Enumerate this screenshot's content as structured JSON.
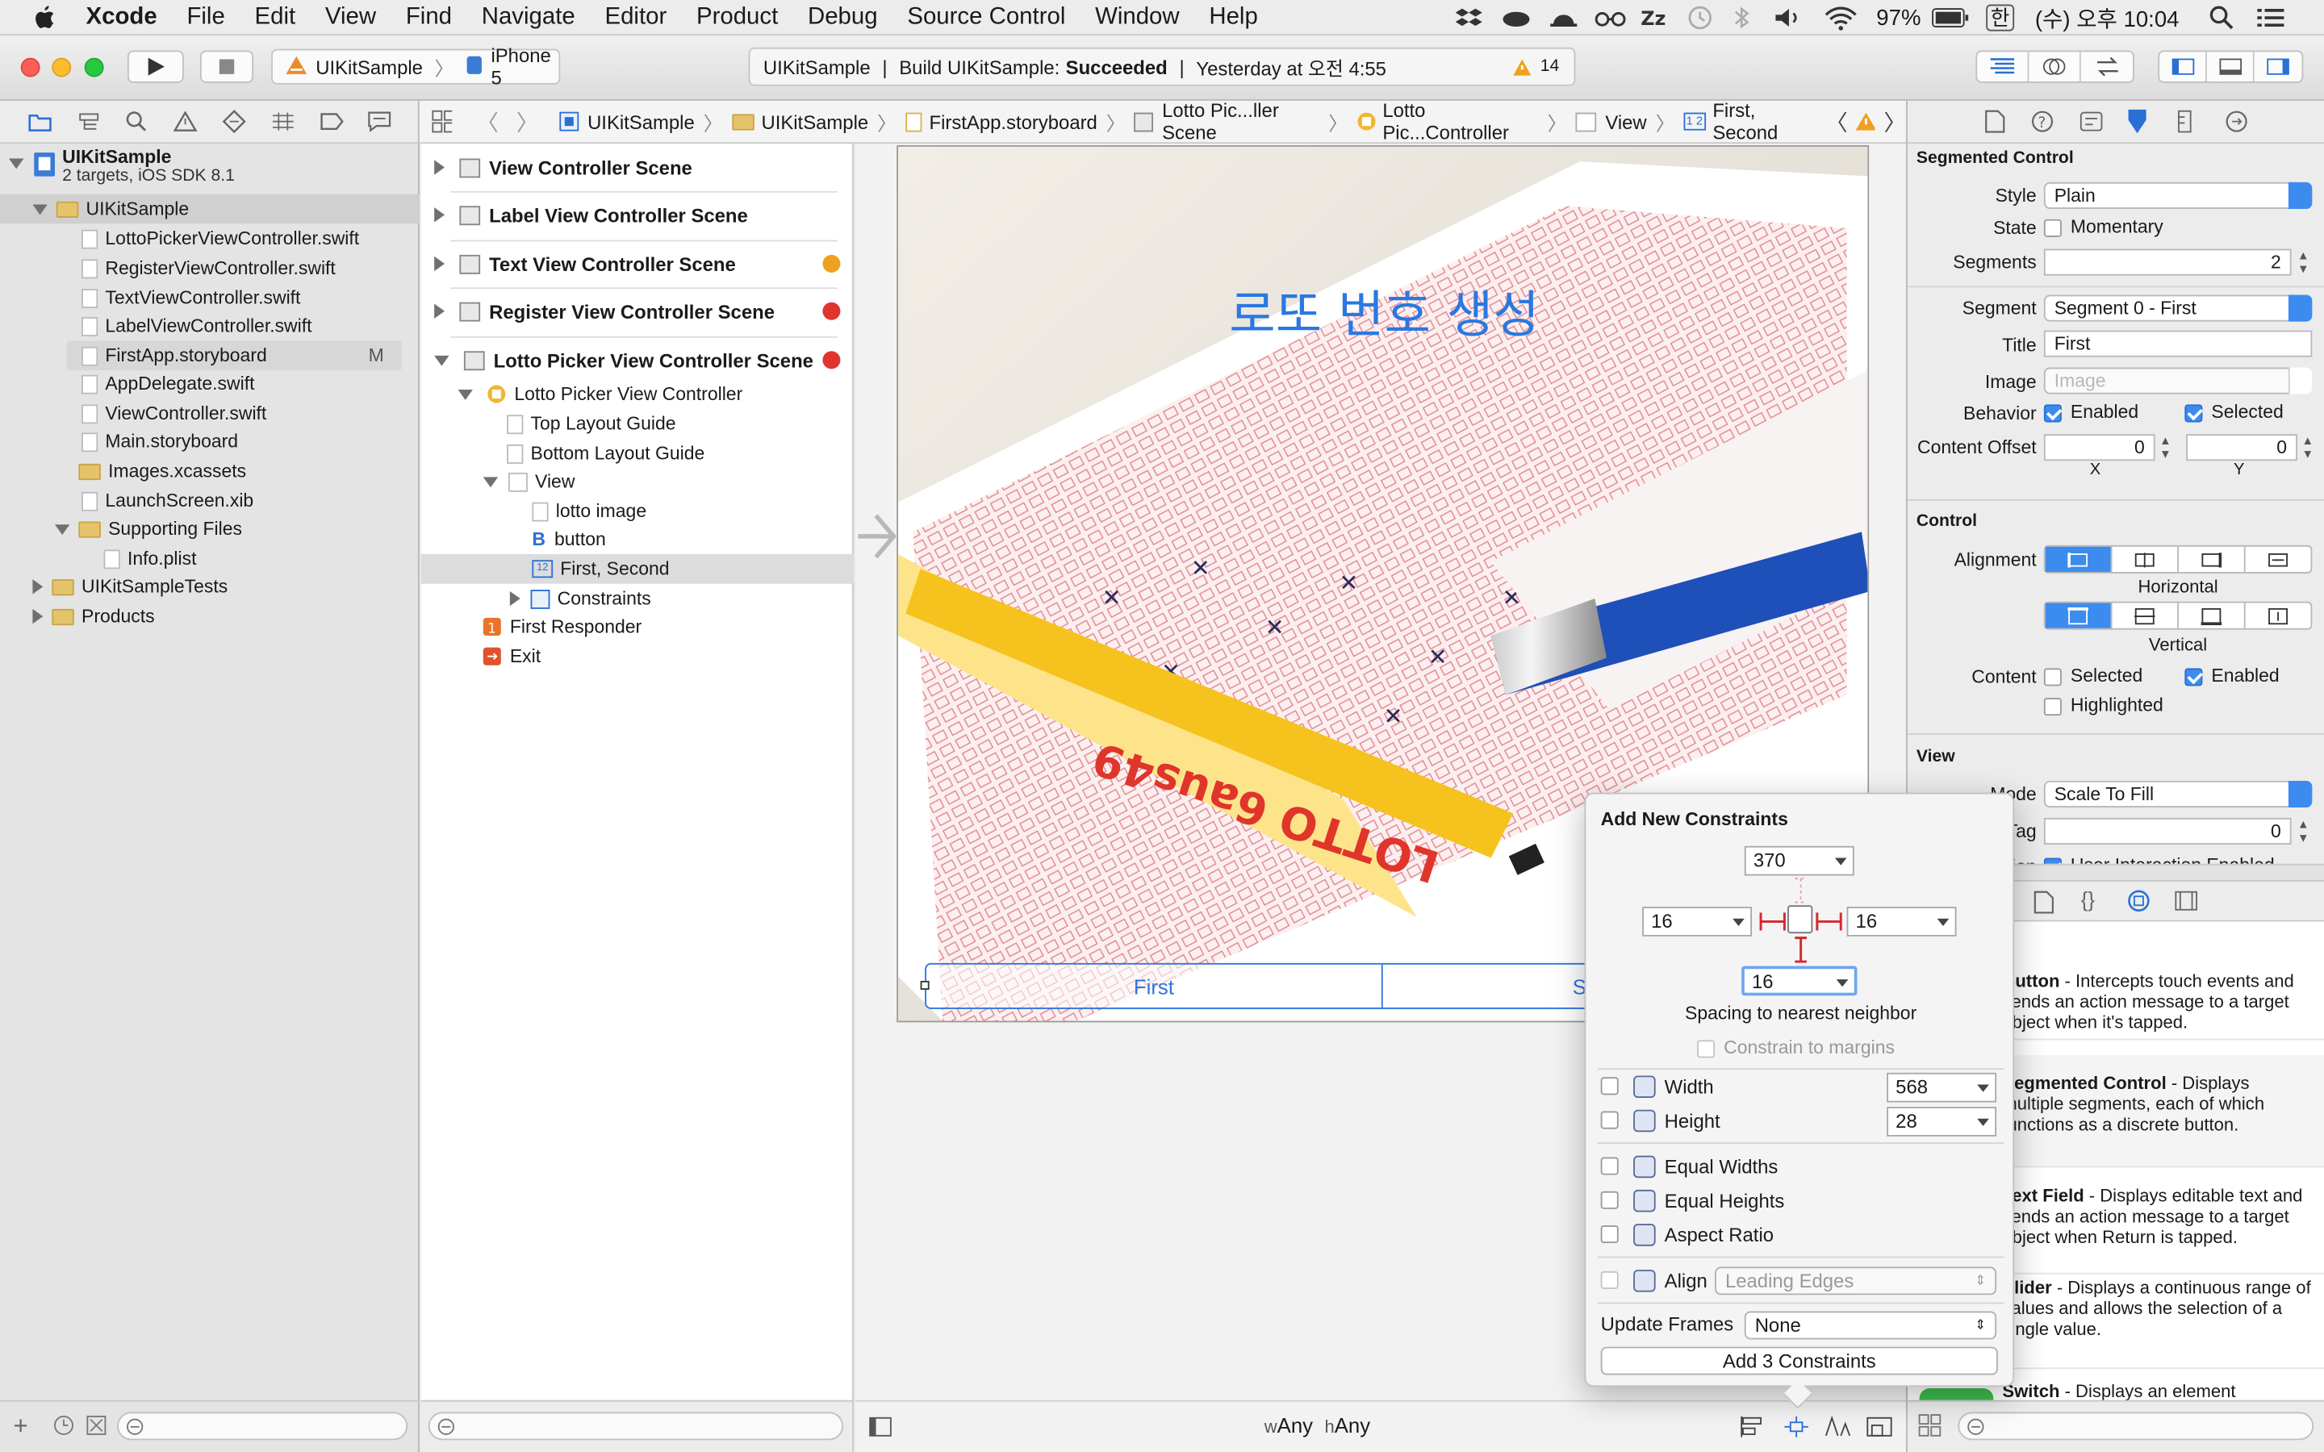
{
  "menubar": {
    "app": "Xcode",
    "items": [
      "File",
      "Edit",
      "View",
      "Find",
      "Navigate",
      "Editor",
      "Product",
      "Debug",
      "Source Control",
      "Window",
      "Help"
    ],
    "battery": "97%",
    "input_source": "한",
    "clock": "(수) 오후 10:04"
  },
  "toolbar": {
    "scheme": "UIKitSample",
    "device": "iPhone 5",
    "activity_project": "UIKitSample",
    "activity_build_prefix": "Build UIKitSample:",
    "activity_build_status": "Succeeded",
    "activity_time": "Yesterday at 오전 4:55",
    "warning_count": "14"
  },
  "jumpbar": {
    "crumbs": [
      "UIKitSample",
      "UIKitSample",
      "FirstApp.storyboard",
      "Lotto Pic...ller Scene",
      "Lotto Pic...Controller",
      "View",
      "First, Second"
    ]
  },
  "navigator": {
    "project_name": "UIKitSample",
    "project_sub": "2 targets, iOS SDK 8.1",
    "items": [
      {
        "label": "UIKitSample",
        "type": "folder",
        "indent": 1,
        "open": true,
        "selected": true
      },
      {
        "label": "LottoPickerViewController.swift",
        "type": "swift",
        "indent": 2
      },
      {
        "label": "RegisterViewController.swift",
        "type": "swift",
        "indent": 2
      },
      {
        "label": "TextViewController.swift",
        "type": "swift",
        "indent": 2
      },
      {
        "label": "LabelViewController.swift",
        "type": "swift",
        "indent": 2
      },
      {
        "label": "FirstApp.storyboard",
        "type": "storyboard",
        "indent": 2,
        "badge": "M",
        "hover": true
      },
      {
        "label": "AppDelegate.swift",
        "type": "swift",
        "indent": 2
      },
      {
        "label": "ViewController.swift",
        "type": "swift",
        "indent": 2
      },
      {
        "label": "Main.storyboard",
        "type": "storyboard",
        "indent": 2
      },
      {
        "label": "Images.xcassets",
        "type": "assets",
        "indent": 2
      },
      {
        "label": "LaunchScreen.xib",
        "type": "xib",
        "indent": 2
      },
      {
        "label": "Supporting Files",
        "type": "folder",
        "indent": 2,
        "open": true
      },
      {
        "label": "Info.plist",
        "type": "plist",
        "indent": 3
      },
      {
        "label": "UIKitSampleTests",
        "type": "folder",
        "indent": 1,
        "open": false
      },
      {
        "label": "Products",
        "type": "folder",
        "indent": 1,
        "open": false
      }
    ]
  },
  "outline": {
    "scenes": [
      {
        "label": "View Controller Scene",
        "status": ""
      },
      {
        "label": "Label View Controller Scene",
        "status": ""
      },
      {
        "label": "Text View Controller Scene",
        "status": "warning"
      },
      {
        "label": "Register View Controller Scene",
        "status": "error"
      },
      {
        "label": "Lotto Picker View Controller Scene",
        "status": "error"
      }
    ],
    "children": [
      {
        "label": "Lotto Picker View Controller",
        "indent": 1,
        "icon": "vc"
      },
      {
        "label": "Top Layout Guide",
        "indent": 2,
        "icon": "guide"
      },
      {
        "label": "Bottom Layout Guide",
        "indent": 2,
        "icon": "guide"
      },
      {
        "label": "View",
        "indent": 2,
        "icon": "view"
      },
      {
        "label": "lotto image",
        "indent": 3,
        "icon": "image"
      },
      {
        "label": "button",
        "indent": 3,
        "icon": "button"
      },
      {
        "label": "First, Second",
        "indent": 3,
        "icon": "segment",
        "selected": true
      },
      {
        "label": "Constraints",
        "indent": 3,
        "icon": "constraints"
      },
      {
        "label": "First Responder",
        "indent": 1,
        "icon": "responder"
      },
      {
        "label": "Exit",
        "indent": 1,
        "icon": "exit"
      }
    ]
  },
  "canvas": {
    "title": "로또 번호 생성",
    "segment_first": "First",
    "segment_second_visible": "S",
    "size_class_w_prefix": "w",
    "size_class_w": "Any",
    "size_class_h_prefix": "h",
    "size_class_h": "Any"
  },
  "inspector": {
    "section_segmented": "Segmented Control",
    "style_label": "Style",
    "style_value": "Plain",
    "state_label": "State",
    "state_value": "Momentary",
    "segments_label": "Segments",
    "segments_value": "2",
    "segment_label": "Segment",
    "segment_value": "Segment 0 - First",
    "title_label": "Title",
    "title_value": "First",
    "image_label": "Image",
    "image_placeholder": "Image",
    "behavior_label": "Behavior",
    "behavior_enabled": "Enabled",
    "behavior_selected": "Selected",
    "offset_label": "Content Offset",
    "offset_x": "0",
    "offset_y": "0",
    "x_caption": "X",
    "y_caption": "Y",
    "section_control": "Control",
    "alignment_label": "Alignment",
    "horizontal_caption": "Horizontal",
    "vertical_caption": "Vertical",
    "content_label": "Content",
    "content_selected": "Selected",
    "content_enabled": "Enabled",
    "content_highlighted": "Highlighted",
    "section_view": "View",
    "mode_label": "Mode",
    "mode_value": "Scale To Fill",
    "tag_label": "Tag",
    "tag_value": "0",
    "interaction_label": "Interaction",
    "interaction_value": "User Interaction Enabled"
  },
  "library": {
    "items": [
      {
        "name": "Button",
        "desc": " - Intercepts touch events and sends an action message to a target object when it's tapped."
      },
      {
        "name": "Segmented Control",
        "desc": " - Displays multiple segments, each of which functions as a discrete button."
      },
      {
        "name": "Text Field",
        "desc": " - Displays editable text and sends an action message to a target object when Return is tapped."
      },
      {
        "name": "Slider",
        "desc": " - Displays a continuous range of values and allows the selection of a single value."
      },
      {
        "name": "Switch",
        "desc": " - Displays an element"
      }
    ]
  },
  "popover": {
    "title": "Add New Constraints",
    "top": "370",
    "left": "16",
    "right": "16",
    "bottom": "16",
    "spacing_caption": "Spacing to nearest neighbor",
    "constrain_margins": "Constrain to margins",
    "width_label": "Width",
    "width_value": "568",
    "height_label": "Height",
    "height_value": "28",
    "equal_widths": "Equal Widths",
    "equal_heights": "Equal Heights",
    "aspect_ratio": "Aspect Ratio",
    "align_label": "Align",
    "align_value": "Leading Edges",
    "update_frames_label": "Update Frames",
    "update_frames_value": "None",
    "add_button": "Add 3 Constraints"
  },
  "colors": {
    "accent": "#3c8cf0",
    "error": "#e0352b",
    "warning": "#f0a020",
    "constraint_red": "#d8262f",
    "segment_blue": "#2d75e0"
  }
}
